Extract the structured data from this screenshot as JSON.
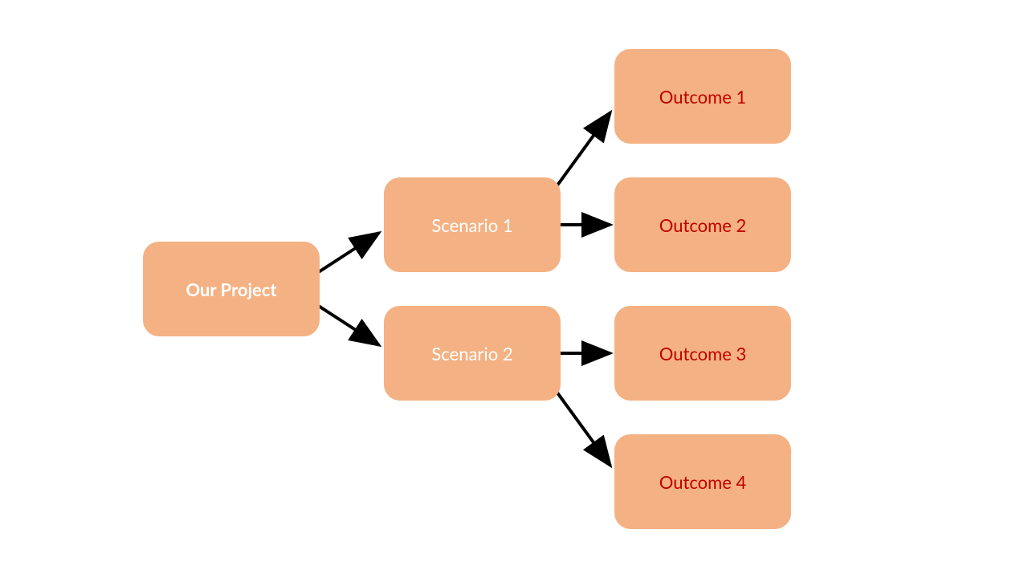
{
  "root": {
    "label": "Our Project"
  },
  "scenarios": [
    {
      "label": "Scenario 1"
    },
    {
      "label": "Scenario 2"
    }
  ],
  "outcomes": [
    {
      "label": "Outcome 1"
    },
    {
      "label": "Outcome 2"
    },
    {
      "label": "Outcome 3"
    },
    {
      "label": "Outcome 4"
    }
  ],
  "colors": {
    "node_bg": "#f4b183",
    "root_text": "#ffffff",
    "scenario_text": "#ffffff",
    "outcome_text": "#c00000",
    "arrow": "#000000"
  }
}
